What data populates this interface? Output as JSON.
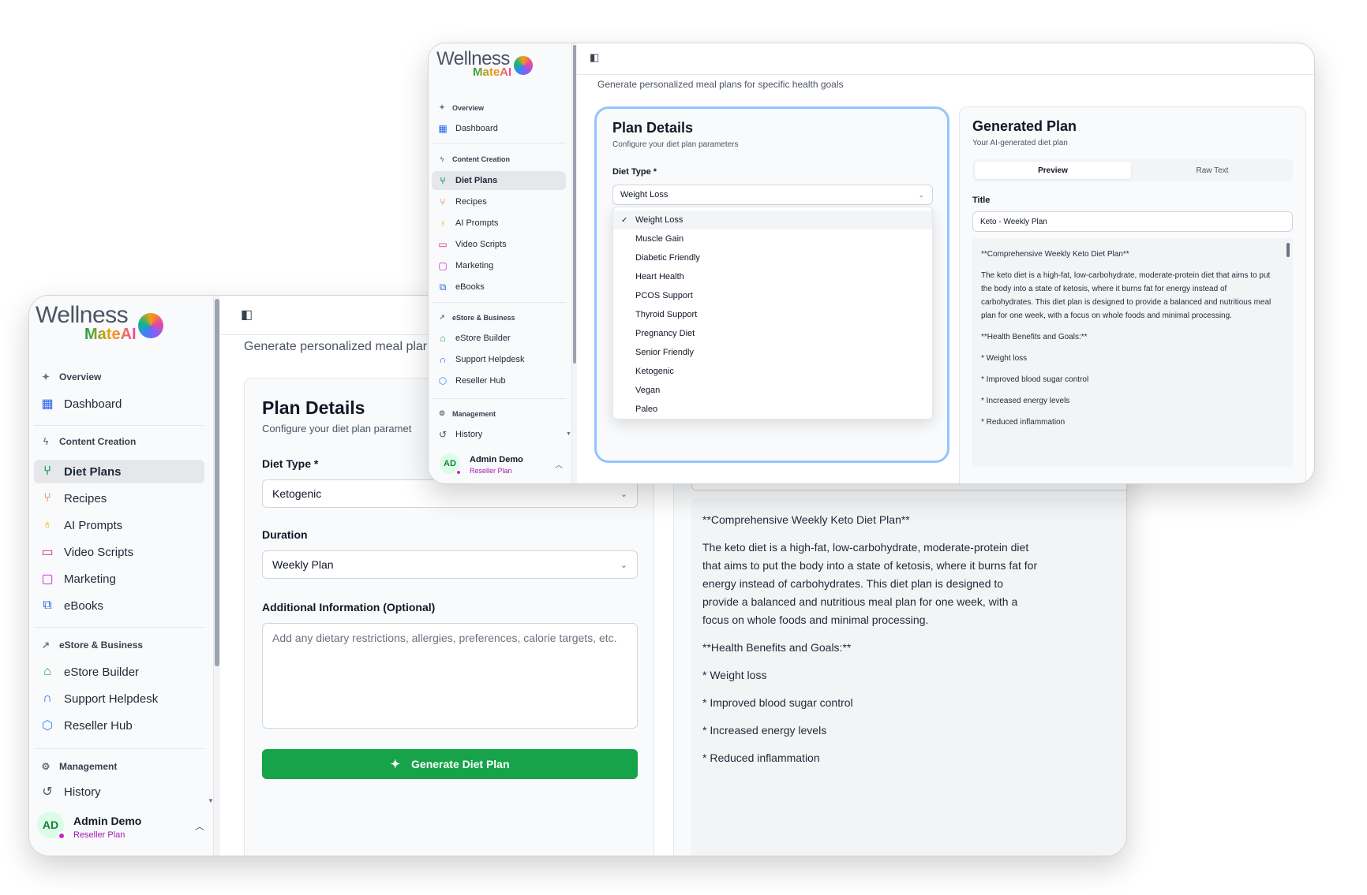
{
  "brand": {
    "word": "Wellness",
    "sub": "MateAI"
  },
  "colors": {
    "accent_green": "#16a34a",
    "plan_magenta": "#a21caf",
    "focus_blue": "#93c5fd"
  },
  "sidebar": {
    "sections": [
      {
        "label": "Overview",
        "icon": "sparkle-icon",
        "items": [
          {
            "label": "Dashboard",
            "icon": "dashboard-grid-icon",
            "color": "#2563eb"
          }
        ]
      },
      {
        "label": "Content Creation",
        "icon": "bolt-icon",
        "items": [
          {
            "label": "Diet Plans",
            "icon": "utensils-icon",
            "color": "#16a34a",
            "active": true
          },
          {
            "label": "Recipes",
            "icon": "fork-knife-icon",
            "color": "#ea580c"
          },
          {
            "label": "AI Prompts",
            "icon": "lightbulb-icon",
            "color": "#eab308"
          },
          {
            "label": "Video Scripts",
            "icon": "video-icon",
            "color": "#db2777"
          },
          {
            "label": "Marketing",
            "icon": "message-icon",
            "color": "#c026d3"
          },
          {
            "label": "eBooks",
            "icon": "book-icon",
            "color": "#2563eb"
          }
        ]
      },
      {
        "label": "eStore & Business",
        "icon": "trend-icon",
        "items": [
          {
            "label": "eStore Builder",
            "icon": "store-icon",
            "color": "#16a34a"
          },
          {
            "label": "Support Helpdesk",
            "icon": "headset-icon",
            "color": "#2563eb"
          },
          {
            "label": "Reseller Hub",
            "icon": "package-icon",
            "color": "#3b82f6"
          }
        ]
      },
      {
        "label": "Management",
        "icon": "gear-icon",
        "items": [
          {
            "label": "History",
            "icon": "history-icon",
            "color": "#4b5563"
          }
        ]
      }
    ],
    "user": {
      "initials": "AD",
      "name": "Admin Demo",
      "plan": "Reseller Plan"
    }
  },
  "page": {
    "subtitle_front": "Generate personalized meal plar",
    "subtitle_back": "Generate personalized meal plans for specific health goals"
  },
  "plan_details": {
    "title": "Plan Details",
    "subtitle_front": "Configure your diet plan paramet",
    "subtitle_back": "Configure your diet plan parameters",
    "diet_type_label": "Diet Type *",
    "diet_type_value_front": "Ketogenic",
    "diet_type_value_back": "Weight Loss",
    "duration_label": "Duration",
    "duration_value": "Weekly Plan",
    "additional_label": "Additional Information (Optional)",
    "additional_placeholder": "Add any dietary restrictions, allergies, preferences, calorie targets, etc.",
    "generate_button": "Generate Diet Plan"
  },
  "diet_options": [
    "Weight Loss",
    "Muscle Gain",
    "Diabetic Friendly",
    "Heart Health",
    "PCOS Support",
    "Thyroid Support",
    "Pregnancy Diet",
    "Senior Friendly",
    "Ketogenic",
    "Vegan",
    "Paleo"
  ],
  "generated": {
    "title": "Generated Plan",
    "subtitle": "Your AI-generated diet plan",
    "tabs": [
      "Preview",
      "Raw Text"
    ],
    "title_label": "Title",
    "title_value": "Keto - Weekly Plan",
    "paragraphs": [
      "**Comprehensive Weekly Keto Diet Plan**",
      "The keto diet is a high-fat, low-carbohydrate, moderate-protein diet that aims to put the body into a state of ketosis, where it burns fat for energy instead of carbohydrates. This diet plan is designed to provide a balanced and nutritious meal plan for one week, with a focus on whole foods and minimal processing.",
      "**Health Benefits and Goals:**",
      "* Weight loss",
      "* Improved blood sugar control",
      "* Increased energy levels",
      "* Reduced inflammation"
    ]
  }
}
